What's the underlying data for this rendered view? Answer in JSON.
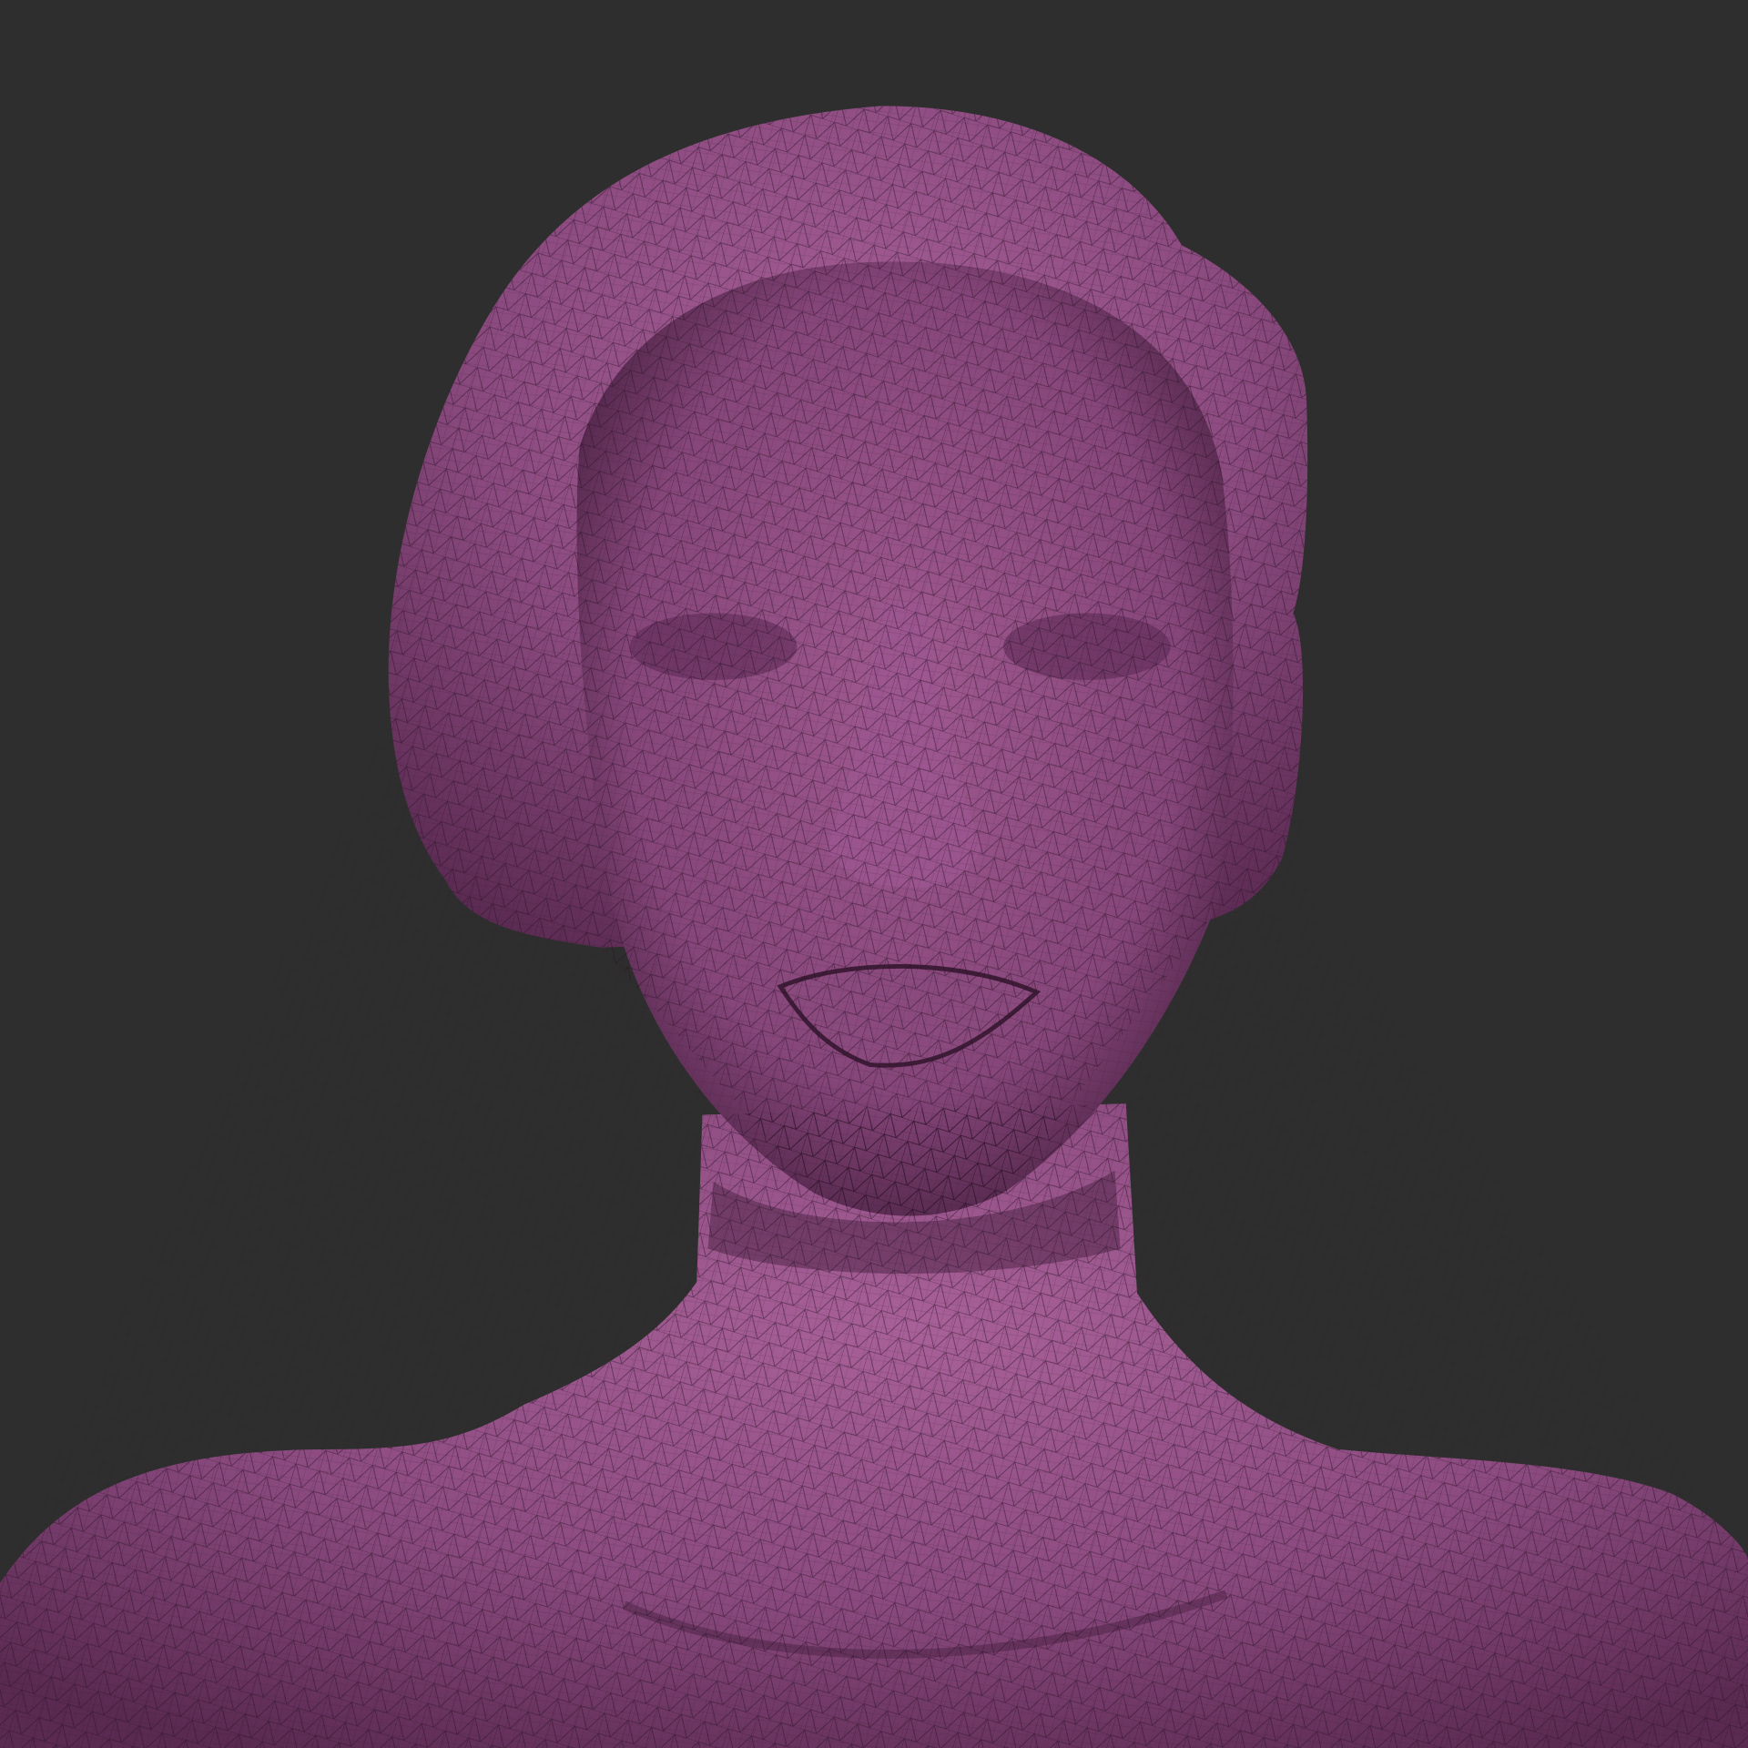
{
  "viewport": {
    "background_color": "#2e2e2e",
    "mesh_color": "#8c4b80",
    "mesh_highlight": "#a86198",
    "mesh_shadow": "#3e1c38",
    "wire_color": "#2a1026"
  },
  "model": {
    "subject": "bust-mesh",
    "display_mode": "wireframe-over-shaded"
  }
}
